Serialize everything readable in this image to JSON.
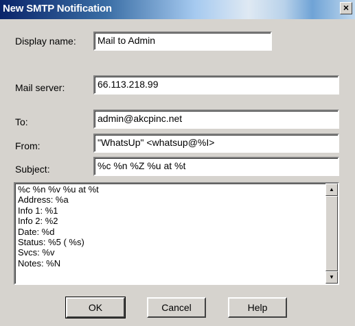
{
  "window": {
    "title": "New SMTP Notification",
    "close_glyph": "×"
  },
  "form": {
    "display_name": {
      "label": "Display name:",
      "value": "Mail to Admin"
    },
    "mail_server": {
      "label": "Mail server:",
      "value": "66.113.218.99"
    },
    "to": {
      "label": "To:",
      "value": "admin@akcpinc.net"
    },
    "from": {
      "label": "From:",
      "value": "\"WhatsUp\" <whatsup@%I>"
    },
    "subject": {
      "label": "Subject:",
      "value": "%c %n %Z %u at %t"
    }
  },
  "message": {
    "lines": [
      "%c %n %v %u at %t",
      "Address: %a",
      "Info 1: %1",
      "Info 2: %2",
      "Date: %d",
      "Status: %5 ( %s)",
      "Svcs: %v",
      "Notes: %N"
    ]
  },
  "scrollbar": {
    "up_glyph": "▲",
    "down_glyph": "▼"
  },
  "buttons": {
    "ok": "OK",
    "cancel": "Cancel",
    "help": "Help"
  }
}
